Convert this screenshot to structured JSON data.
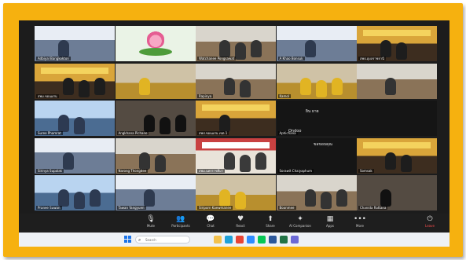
{
  "tiles": [
    {
      "name": "Adbiyal Bangkokton",
      "theme": "office-blue"
    },
    {
      "name": "",
      "theme": "lotus"
    },
    {
      "name": "Watchanee Pongsawat",
      "theme": "meeting-room"
    },
    {
      "name": "A Khao Bonsuk",
      "theme": "office-blue"
    },
    {
      "name": "สพป.อุบลราชธานี",
      "theme": "stage-yellow"
    },
    {
      "name": "สพม.ขอนแก่น",
      "theme": "stage-yellow"
    },
    {
      "name": "",
      "theme": "speaker-yellow"
    },
    {
      "name": "Rapinya",
      "theme": "meeting-room"
    },
    {
      "name": "Kamol",
      "theme": "speaker-yellow"
    },
    {
      "name": "",
      "theme": "meeting-room"
    },
    {
      "name": "Suree Phamrat",
      "theme": "classroom-blue"
    },
    {
      "name": "Angkhana Pichano",
      "theme": "person-dark"
    },
    {
      "name": "สพป.ขอนแก่น เขต 1",
      "theme": "stage-yellow"
    },
    {
      "name": "Aphichana",
      "theme": "caption"
    },
    {
      "name": "",
      "theme": "caption"
    },
    {
      "name": "Sirinya Supalak",
      "theme": "office-blue"
    },
    {
      "name": "Narong Thongdee",
      "theme": "meeting-room"
    },
    {
      "name": "สพม.นครราชสีมา",
      "theme": "conference"
    },
    {
      "name": "Sorawit Chaiyaphum",
      "theme": "caption"
    },
    {
      "name": "Somsak",
      "theme": "stage-yellow"
    },
    {
      "name": "Pranee Suwan",
      "theme": "classroom-blue"
    },
    {
      "name": "Tawan Yangyuen",
      "theme": "office-blue"
    },
    {
      "name": "Siriporn Kaewmanee",
      "theme": "speaker-yellow"
    },
    {
      "name": "Boonmee",
      "theme": "meeting-room"
    },
    {
      "name": "Chanida Rattana",
      "theme": "person-dark"
    }
  ],
  "caption_texts": {
    "line1": "ยิน ยาย",
    "line2": "ขอขอบคุณ",
    "line3": "Ondoo"
  },
  "toolbar": {
    "items": [
      {
        "icon": "mic-icon",
        "glyph": "🎙",
        "label": "Mute"
      },
      {
        "icon": "participants-icon",
        "glyph": "👥",
        "label": "Participants"
      },
      {
        "icon": "chat-icon",
        "glyph": "💬",
        "label": "Chat"
      },
      {
        "icon": "reactions-icon",
        "glyph": "♥",
        "label": "React"
      },
      {
        "icon": "share-icon",
        "glyph": "⬆",
        "label": "Share"
      },
      {
        "icon": "ai-companion-icon",
        "glyph": "✦",
        "label": "AI Companion"
      },
      {
        "icon": "apps-icon",
        "glyph": "▦",
        "label": "Apps"
      },
      {
        "icon": "more-icon",
        "glyph": "•••",
        "label": "More"
      }
    ],
    "end_label": "Leave"
  },
  "taskbar": {
    "search_placeholder": "Search"
  },
  "colors": {
    "frame": "#f6b10f",
    "screen": "#1c1c1c",
    "leave": "#ff4d4d"
  }
}
